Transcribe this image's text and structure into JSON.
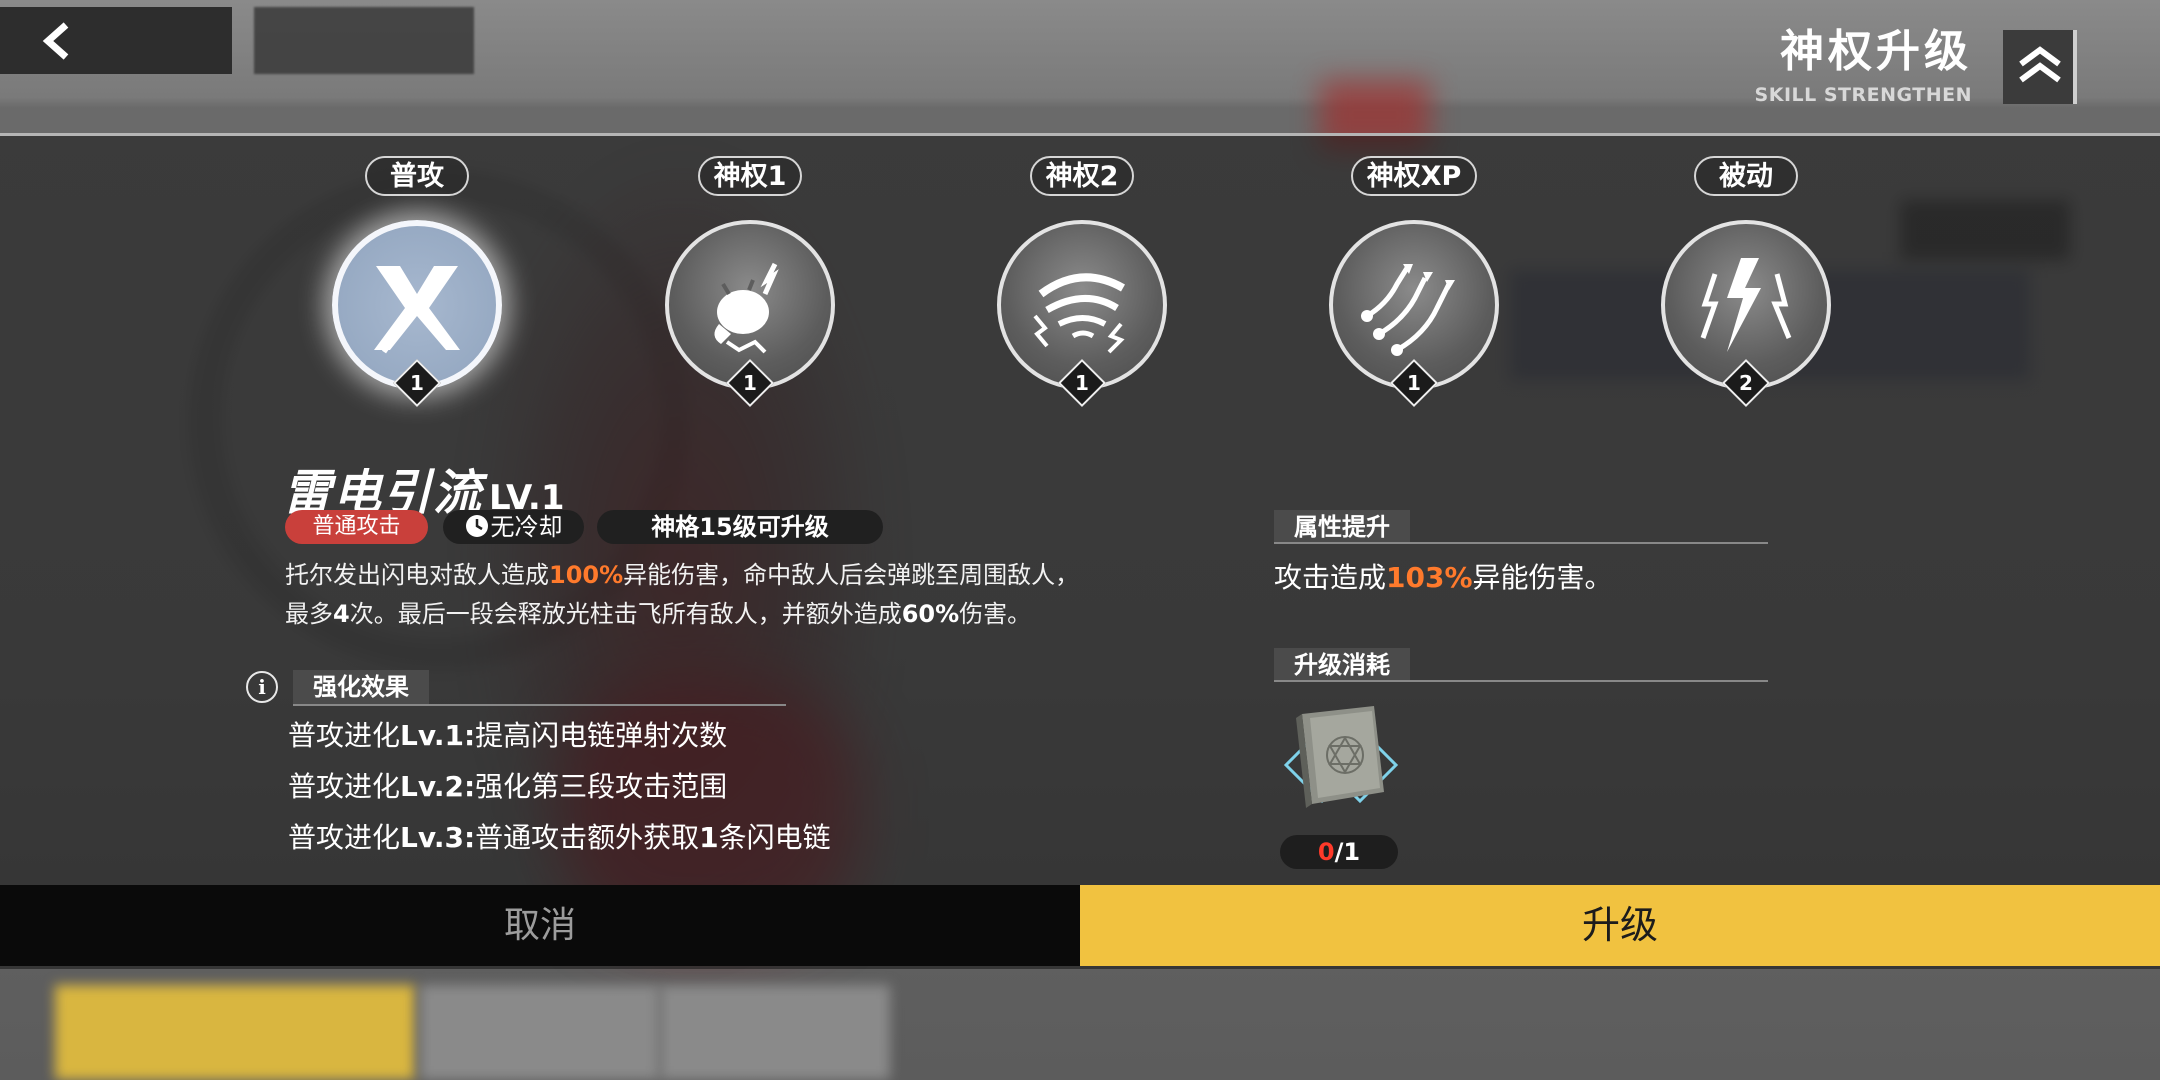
{
  "header": {
    "title_cn": "神权升级",
    "title_en": "SKILL STRENGTHEN"
  },
  "skills": [
    {
      "tab": "普攻",
      "level": "1",
      "active": true,
      "icon": "cross-slash-icon"
    },
    {
      "tab": "神权1",
      "level": "1",
      "active": false,
      "icon": "lightning-fist-icon"
    },
    {
      "tab": "神权2",
      "level": "1",
      "active": false,
      "icon": "lightning-vortex-icon"
    },
    {
      "tab": "神权XP",
      "level": "1",
      "active": false,
      "icon": "lightning-chains-icon"
    },
    {
      "tab": "被动",
      "level": "2",
      "active": false,
      "icon": "lightning-bolts-icon"
    }
  ],
  "detail": {
    "name": "雷电引流",
    "level": "LV.1",
    "type_chip": "普通攻击",
    "cooldown_chip": "无冷却",
    "requirement_chip": "神格15级可升级",
    "desc_1a": "托尔发出闪电对敌人造成",
    "desc_1hl": "100%",
    "desc_1b": "异能伤害，命中敌人后会弹跳至周围敌人，",
    "desc_2a": "最多",
    "desc_2b1": "4",
    "desc_2c": "次。最后一段会释放光柱击飞所有敌人，并额外造成",
    "desc_2b2": "60%",
    "desc_2d": "伤害。"
  },
  "enhance": {
    "heading": "强化效果",
    "items": [
      {
        "prefix": "普攻进化",
        "lv": "Lv.1:",
        "text": "提高闪电链弹射次数"
      },
      {
        "prefix": "普攻进化",
        "lv": "Lv.2:",
        "text": "强化第三段攻击范围"
      },
      {
        "prefix": "普攻进化",
        "lv": "Lv.3:",
        "text": "普通攻击额外获取",
        "num": "1",
        "text2": "条闪电链"
      }
    ]
  },
  "attribute": {
    "heading": "属性提升",
    "text_a": "攻击造成",
    "text_hl": "103%",
    "text_b": "异能伤害。"
  },
  "cost": {
    "heading": "升级消耗",
    "item_icon": "spell-book-icon",
    "owned": "0",
    "required": "/1"
  },
  "buttons": {
    "cancel": "取消",
    "upgrade": "升级"
  },
  "colors": {
    "highlight": "#ff7a2c",
    "upgrade_button": "#f1c240",
    "type_chip": "#c9403b",
    "owned_red": "#ff3a2a"
  }
}
